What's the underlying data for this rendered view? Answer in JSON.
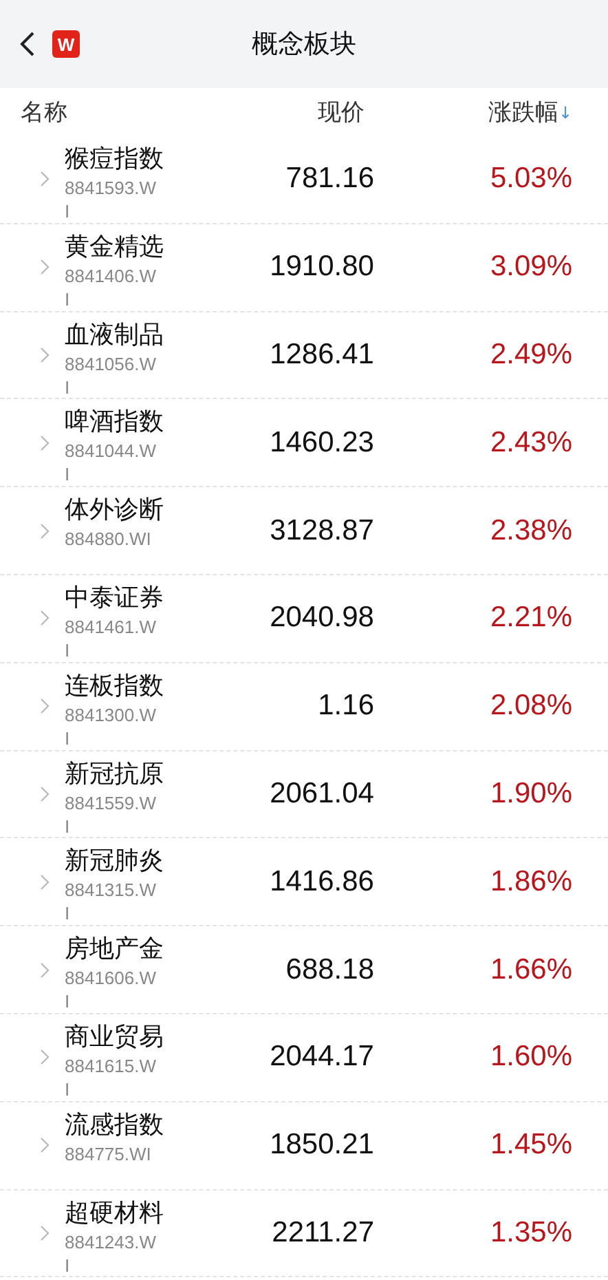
{
  "header": {
    "title": "概念板块",
    "logo": "W"
  },
  "columns": {
    "name": "名称",
    "price": "现价",
    "change": "涨跌幅",
    "sort_arrow": "↓"
  },
  "rows": [
    {
      "name": "猴痘指数",
      "code": "8841593.WI",
      "price": "781.16",
      "change": "5.03%"
    },
    {
      "name": "黄金精选",
      "code": "8841406.WI",
      "price": "1910.80",
      "change": "3.09%"
    },
    {
      "name": "血液制品",
      "code": "8841056.WI",
      "price": "1286.41",
      "change": "2.49%"
    },
    {
      "name": "啤酒指数",
      "code": "8841044.WI",
      "price": "1460.23",
      "change": "2.43%"
    },
    {
      "name": "体外诊断",
      "code": "884880.WI",
      "price": "3128.87",
      "change": "2.38%"
    },
    {
      "name": "中泰证券",
      "code": "8841461.WI",
      "price": "2040.98",
      "change": "2.21%"
    },
    {
      "name": "连板指数",
      "code": "8841300.WI",
      "price": "1.16",
      "change": "2.08%"
    },
    {
      "name": "新冠抗原",
      "code": "8841559.WI",
      "price": "2061.04",
      "change": "1.90%"
    },
    {
      "name": "新冠肺炎",
      "code": "8841315.WI",
      "price": "1416.86",
      "change": "1.86%"
    },
    {
      "name": "房地产金",
      "code": "8841606.WI",
      "price": "688.18",
      "change": "1.66%"
    },
    {
      "name": "商业贸易",
      "code": "8841615.WI",
      "price": "2044.17",
      "change": "1.60%"
    },
    {
      "name": "流感指数",
      "code": "884775.WI",
      "price": "1850.21",
      "change": "1.45%"
    },
    {
      "name": "超硬材料",
      "code": "8841243.WI",
      "price": "2211.27",
      "change": "1.35%"
    }
  ]
}
